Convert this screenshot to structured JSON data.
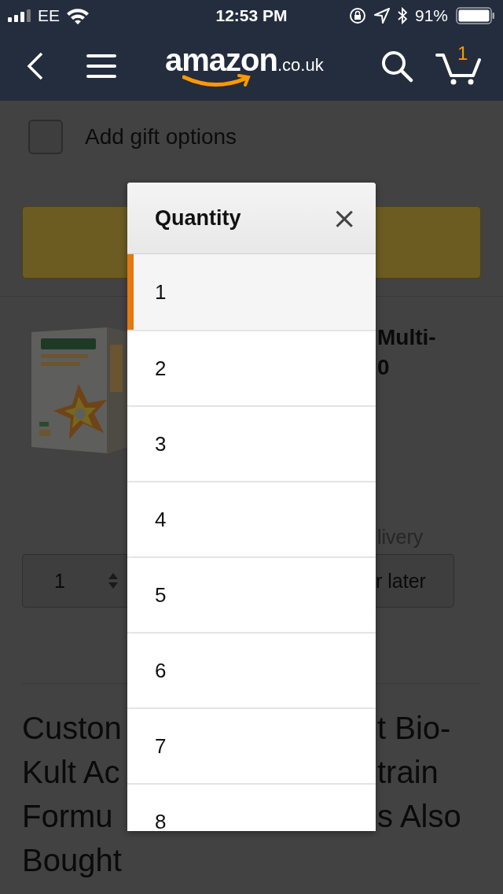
{
  "status_bar": {
    "carrier": "EE",
    "time": "12:53 PM",
    "battery": "91%"
  },
  "header": {
    "logo": "amazon",
    "logo_domain": ".co.uk",
    "cart_count": "1"
  },
  "gift_options": {
    "label": "Add gift options",
    "checked": false
  },
  "product": {
    "title_fragments": [
      "Multi-",
      "0"
    ],
    "delivery_fragment": "livery",
    "quantity": "1",
    "save_fragment": "r later"
  },
  "heading_lines": [
    {
      "left": "Custon",
      "right": "t Bio-"
    },
    {
      "left": "Kult Ac",
      "right": "train"
    },
    {
      "left": "Formu",
      "right": "s Also"
    },
    {
      "left": "Bought"
    }
  ],
  "quantity_modal": {
    "title": "Quantity",
    "close": "×",
    "options": [
      {
        "label": "1",
        "selected": true
      },
      {
        "label": "2",
        "selected": false
      },
      {
        "label": "3",
        "selected": false
      },
      {
        "label": "4",
        "selected": false
      },
      {
        "label": "5",
        "selected": false
      },
      {
        "label": "6",
        "selected": false
      },
      {
        "label": "7",
        "selected": false
      },
      {
        "label": "8",
        "selected": false
      }
    ]
  }
}
